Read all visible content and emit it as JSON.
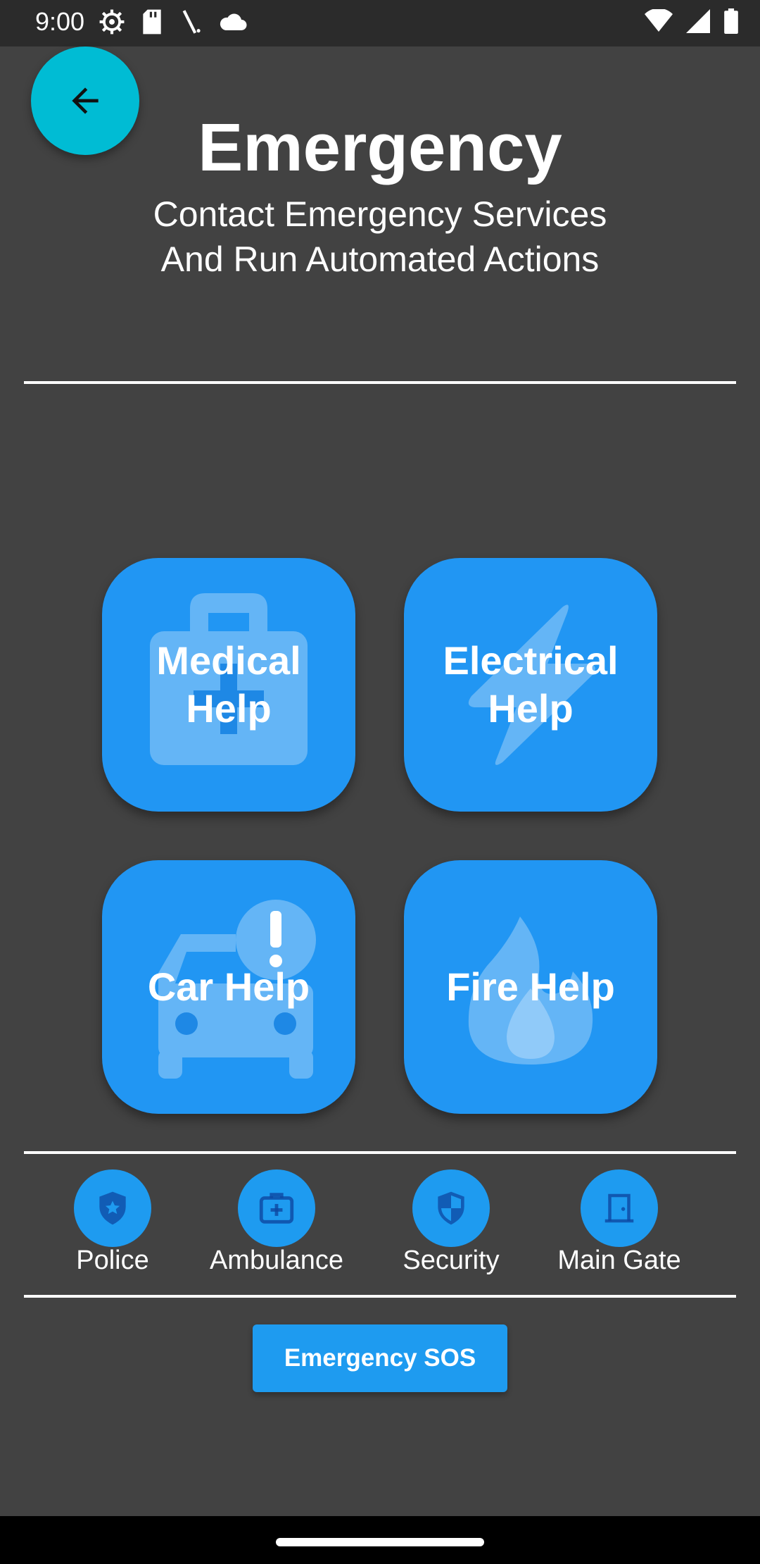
{
  "status_bar": {
    "time": "9:00"
  },
  "header": {
    "title": "Emergency",
    "subtitle_line1": "Contact Emergency Services",
    "subtitle_line2": "And Run Automated Actions"
  },
  "tiles": [
    {
      "label": "Medical\nHelp",
      "icon": "medical-bag-icon"
    },
    {
      "label": "Electrical\nHelp",
      "icon": "lightning-icon"
    },
    {
      "label": "Car Help",
      "icon": "car-alert-icon"
    },
    {
      "label": "Fire Help",
      "icon": "fire-icon"
    }
  ],
  "contacts": [
    {
      "label": "Police",
      "icon": "police-shield-icon"
    },
    {
      "label": "Ambulance",
      "icon": "first-aid-kit-icon"
    },
    {
      "label": "Security",
      "icon": "security-shield-icon"
    },
    {
      "label": "Main Gate",
      "icon": "door-icon"
    }
  ],
  "sos_button": {
    "label": "Emergency SOS"
  },
  "colors": {
    "background": "#424242",
    "accent_fab": "#00BCD4",
    "tile_blue": "#2196F3",
    "contact_blue": "#1E9BF0"
  }
}
